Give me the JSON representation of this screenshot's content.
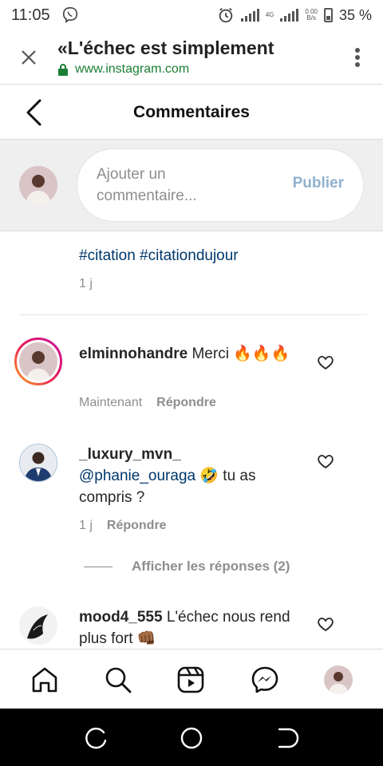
{
  "status": {
    "time": "11:05",
    "battery": "35 %",
    "net_badge": "4G",
    "speed_top": "0.00",
    "speed_bottom": "B/s"
  },
  "browser": {
    "title": "«L'échec est simplement",
    "url": "www.instagram.com"
  },
  "comments_header": {
    "title": "Commentaires"
  },
  "compose": {
    "placeholder": "Ajouter un commentaire...",
    "publish_label": "Publier"
  },
  "caption": {
    "tags": "#citation #citationdujour",
    "time": "1 j"
  },
  "comments": [
    {
      "username": "elminnohandre",
      "text": "Merci 🔥🔥🔥",
      "time": "Maintenant",
      "reply_label": "Répondre"
    },
    {
      "username": "_luxury_mvn_",
      "mention": "@phanie_ouraga",
      "text": "🤣 tu as compris ?",
      "time": "1 j",
      "reply_label": "Répondre"
    },
    {
      "username": "mood4_555",
      "text": "L'échec nous rend plus fort 👊🏾"
    }
  ],
  "view_replies": "Afficher les réponses (2)",
  "colors": {
    "link_blue": "#00376b",
    "publish_disabled": "#8fb1cf",
    "secure_green": "#1b7e34",
    "story_ring_start": "#f9a324",
    "story_ring_end": "#c7149a"
  },
  "bottom_nav": [
    "home-icon",
    "search-icon",
    "reels-icon",
    "messenger-icon",
    "profile-avatar"
  ],
  "android_nav": [
    "recents-button",
    "home-button",
    "back-button"
  ]
}
